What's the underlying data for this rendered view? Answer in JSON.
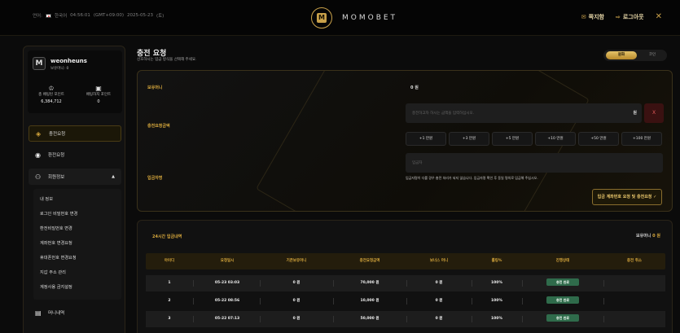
{
  "top": {
    "lang_label": "언어:",
    "region": "한국어",
    "time": "04:56:01",
    "timezone": "(GMT+09:00)",
    "date": "2025-05-23",
    "weekday": "(토)",
    "brand": "MOMOBET",
    "logo_letter": "M",
    "notes_label": "쪽지함",
    "logout_label": "로그아웃",
    "close_glyph": "✕"
  },
  "profile": {
    "username": "weonheuns",
    "balance_label": "보유머니:",
    "balance_value": "0",
    "avatar_letter": "M",
    "stats": [
      {
        "label": "총 배팅된 포인트",
        "value": "6,384,712"
      },
      {
        "label": "배팅하지 포인트",
        "value": "0"
      }
    ]
  },
  "nav": {
    "deposit": "충전요청",
    "withdraw": "환전요청",
    "member_info": "회원정보",
    "money_history": "머니내역",
    "submenu": [
      "내 정보",
      "로그인 비밀번호 변경",
      "환전비밀번호 변경",
      "계좌번호 변경요청",
      "휴대폰번호 변경요청",
      "지갑 주소 관리",
      "계정사용 금지설정"
    ]
  },
  "main": {
    "title": "충전 요청",
    "subtitle": "선호하시는 입금 방식을 선택해 주세요.",
    "toggle_active": "원화",
    "toggle_inactive": "코인",
    "held_money_label": "보유머니",
    "held_money_value": "0 원",
    "amount_label": "충전요청금액",
    "amount_placeholder": "충전하고자 하시는 금액을 입력하십시오.",
    "amount_unit": "원",
    "clear_label": "X",
    "quick_amounts": [
      "+1 만원",
      "+3 만원",
      "+5 만원",
      "+10 만원",
      "+50 만원",
      "+100 만원"
    ],
    "depositor_label": "입금자명",
    "depositor_placeholder": "입금자",
    "notice": "입금자명이 다를 경우 충전 처리가 되지 않습니다. 입금자명 확인 후 동일 명의로 입금해 주십시오.",
    "submit_label": "입금 계좌번호 요청 및 충전요청 ✓"
  },
  "history": {
    "title": "24시간 입금내역",
    "total_label": "보유머니",
    "total_value": "0 원",
    "columns": [
      "아이디",
      "요청일시",
      "기존보유머니",
      "충전요청금액",
      "보너스 머니",
      "롤링%",
      "진행상태",
      "충전 취소"
    ],
    "rows": [
      [
        "1",
        "05-23 03:03",
        "0 원",
        "70,000 원",
        "0 원",
        "100%",
        "충전 완료",
        ""
      ],
      [
        "2",
        "05-22 08:56",
        "0 원",
        "10,000 원",
        "0 원",
        "100%",
        "충전 완료",
        ""
      ],
      [
        "3",
        "05-22 07:13",
        "0 원",
        "50,000 원",
        "0 원",
        "100%",
        "충전 완료",
        ""
      ]
    ]
  },
  "colors": {
    "accent": "#d6a73c",
    "status_green": "#2f6b4b",
    "background": "#0b0b0b"
  }
}
